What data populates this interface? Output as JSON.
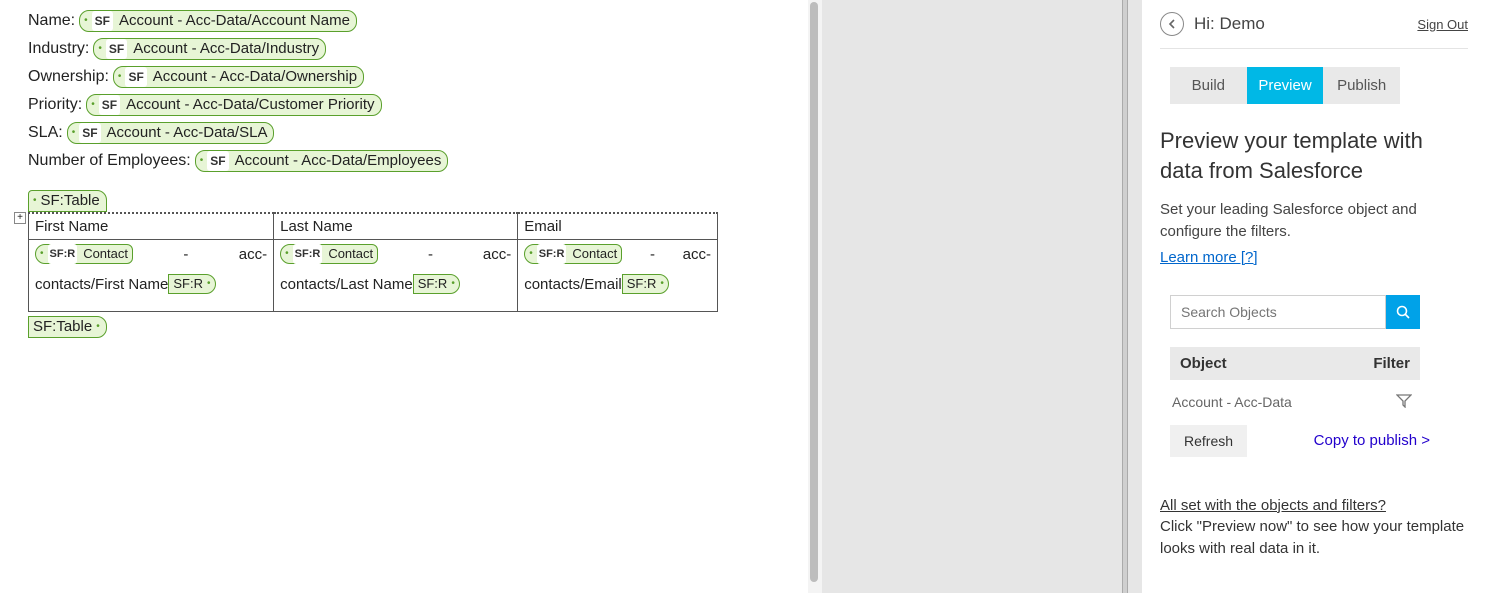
{
  "editor": {
    "fields": [
      {
        "label": "Name:",
        "sf_badge": "SF",
        "token": "Account - Acc-Data/Account Name"
      },
      {
        "label": "Industry:",
        "sf_badge": "SF",
        "token": "Account - Acc-Data/Industry"
      },
      {
        "label": "Ownership:",
        "sf_badge": "SF",
        "token": "Account - Acc-Data/Ownership"
      },
      {
        "label": "Priority:",
        "sf_badge": "SF",
        "token": "Account - Acc-Data/Customer Priority"
      },
      {
        "label": "SLA:",
        "sf_badge": "SF",
        "token": "Account - Acc-Data/SLA"
      },
      {
        "label": "Number of Employees:",
        "sf_badge": "SF",
        "token": "Account - Acc-Data/Employees"
      }
    ],
    "table": {
      "open_label": "SF:Table",
      "close_label": "SF:Table",
      "expand_glyph": "+",
      "resize_glyph": "↘",
      "columns": [
        {
          "header": "First Name",
          "row_badge": "SF:R",
          "row_obj": "Contact",
          "row_dash": "-",
          "row_suffix": "acc-",
          "path": "contacts/First Name",
          "close_badge": "SF:R"
        },
        {
          "header": "Last Name",
          "row_badge": "SF:R",
          "row_obj": "Contact",
          "row_dash": "-",
          "row_suffix": "acc-",
          "path": "contacts/Last Name",
          "close_badge": "SF:R"
        },
        {
          "header": "Email",
          "row_badge": "SF:R",
          "row_obj": "Contact",
          "row_dash": "-",
          "row_suffix": "acc-",
          "path": "contacts/Email",
          "close_badge": "SF:R"
        }
      ]
    }
  },
  "taskpane": {
    "header": {
      "greeting": "Hi: Demo",
      "signout": "Sign Out"
    },
    "tabs": {
      "build": "Build",
      "preview": "Preview",
      "publish": "Publish"
    },
    "heading": "Preview your template with data from Salesforce",
    "body": "Set your leading Salesforce object and configure the filters.",
    "learn_more": "Learn more [?]",
    "search": {
      "placeholder": "Search Objects"
    },
    "object_table": {
      "col_object": "Object",
      "col_filter": "Filter",
      "row_object": "Account - Acc-Data"
    },
    "refresh": "Refresh",
    "copy_to_publish": "Copy to publish >",
    "done": {
      "line1": "All set with the objects and filters?",
      "line2": "Click \"Preview now\" to see how your template looks with real data in it."
    }
  }
}
